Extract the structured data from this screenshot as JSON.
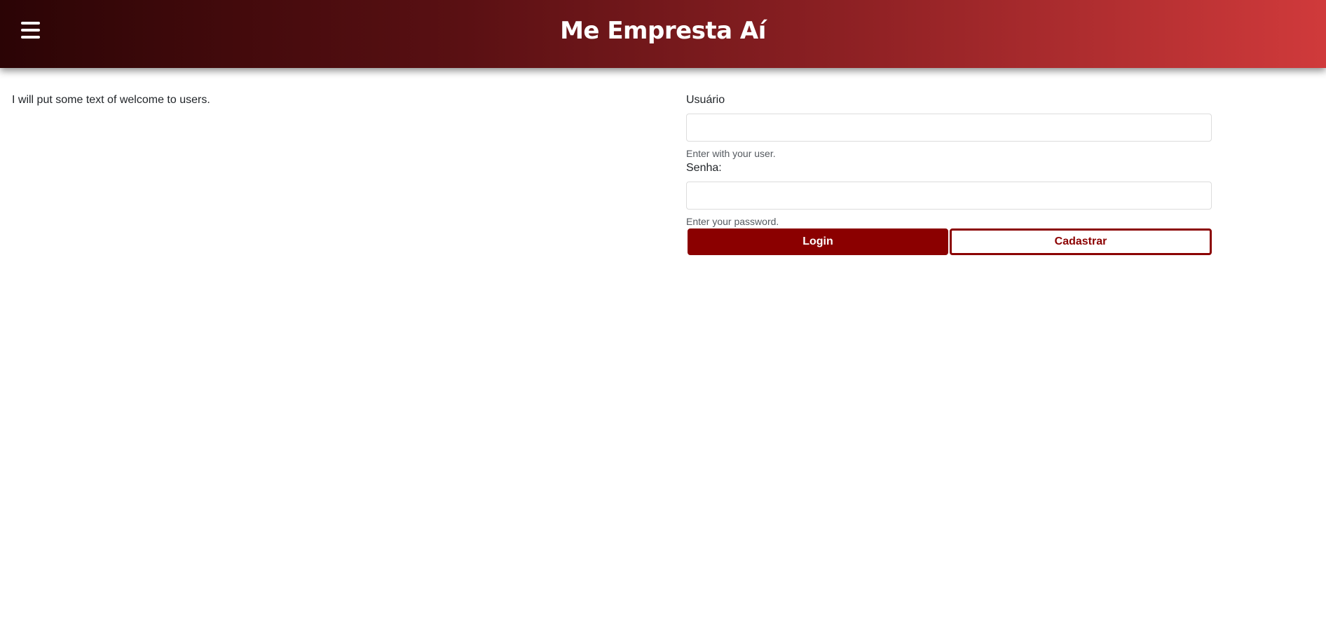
{
  "header": {
    "menu_icon": "hamburger-menu-icon",
    "title": "Me Empresta Aí"
  },
  "main": {
    "welcome_text": "I will put some text of welcome to users."
  },
  "login_form": {
    "user_label": "Usuário",
    "user_value": "",
    "user_help": "Enter with your user.",
    "password_label": "Senha:",
    "password_value": "",
    "password_help": "Enter your password.",
    "login_button": "Login",
    "register_button": "Cadastrar"
  },
  "colors": {
    "header_gradient_start": "#2b0405",
    "header_gradient_end": "#d03a3b",
    "primary": "#8b0000",
    "text": "#212529",
    "help_text": "#555a60"
  }
}
